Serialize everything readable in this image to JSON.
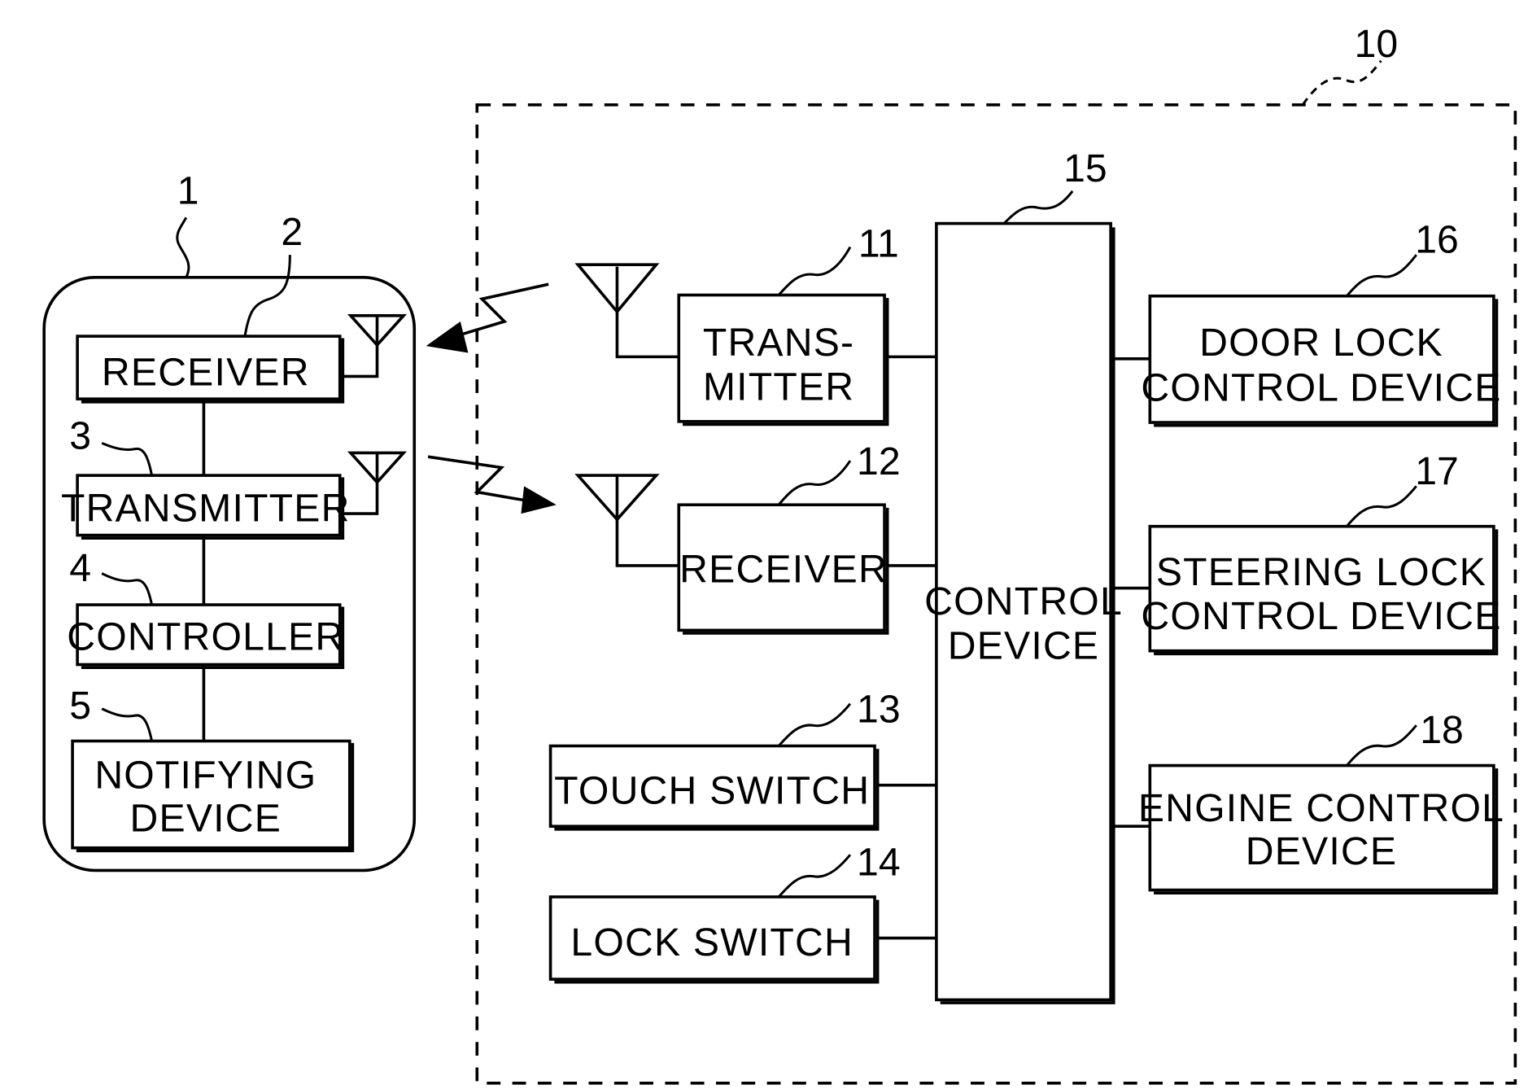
{
  "figure": {
    "type": "block diagram",
    "description": "Keyless entry system: portable device communicating wirelessly with vehicle-side unit"
  },
  "portable_device": {
    "ref": "1",
    "components": [
      {
        "ref": "2",
        "label": "RECEIVER",
        "lines": [
          "RECEIVER"
        ],
        "has_antenna": true
      },
      {
        "ref": "3",
        "label": "TRANSMITTER",
        "lines": [
          "TRANSMITTER"
        ],
        "has_antenna": true
      },
      {
        "ref": "4",
        "label": "CONTROLLER",
        "lines": [
          "CONTROLLER"
        ],
        "has_antenna": false
      },
      {
        "ref": "5",
        "label": "NOTIFYING DEVICE",
        "lines": [
          "NOTIFYING",
          "DEVICE"
        ],
        "has_antenna": false
      }
    ]
  },
  "vehicle_unit": {
    "ref": "10",
    "components": [
      {
        "ref": "11",
        "label": "TRANSMITTER",
        "lines": [
          "TRANS-",
          "MITTER"
        ],
        "has_antenna": true
      },
      {
        "ref": "12",
        "label": "RECEIVER",
        "lines": [
          "RECEIVER"
        ],
        "has_antenna": true
      },
      {
        "ref": "13",
        "label": "TOUCH SWITCH",
        "lines": [
          "TOUCH SWITCH"
        ],
        "has_antenna": false
      },
      {
        "ref": "14",
        "label": "LOCK SWITCH",
        "lines": [
          "LOCK SWITCH"
        ],
        "has_antenna": false
      },
      {
        "ref": "15",
        "label": "CONTROL DEVICE",
        "lines": [
          "CONTROL",
          "DEVICE"
        ],
        "has_antenna": false
      },
      {
        "ref": "16",
        "label": "DOOR LOCK CONTROL DEVICE",
        "lines": [
          "DOOR LOCK",
          "CONTROL DEVICE"
        ],
        "has_antenna": false
      },
      {
        "ref": "17",
        "label": "STEERING LOCK CONTROL DEVICE",
        "lines": [
          "STEERING LOCK",
          "CONTROL DEVICE"
        ],
        "has_antenna": false
      },
      {
        "ref": "18",
        "label": "ENGINE CONTROL DEVICE",
        "lines": [
          "ENGINE CONTROL",
          "DEVICE"
        ],
        "has_antenna": false
      }
    ]
  },
  "wireless_links": [
    {
      "from": "11",
      "to": "2",
      "direction": "vehicle-to-portable"
    },
    {
      "from": "3",
      "to": "12",
      "direction": "portable-to-vehicle"
    }
  ],
  "connections": [
    [
      "2",
      "3"
    ],
    [
      "3",
      "4"
    ],
    [
      "4",
      "5"
    ],
    [
      "11",
      "15"
    ],
    [
      "12",
      "15"
    ],
    [
      "13",
      "15"
    ],
    [
      "14",
      "15"
    ],
    [
      "15",
      "16"
    ],
    [
      "15",
      "17"
    ],
    [
      "15",
      "18"
    ]
  ]
}
